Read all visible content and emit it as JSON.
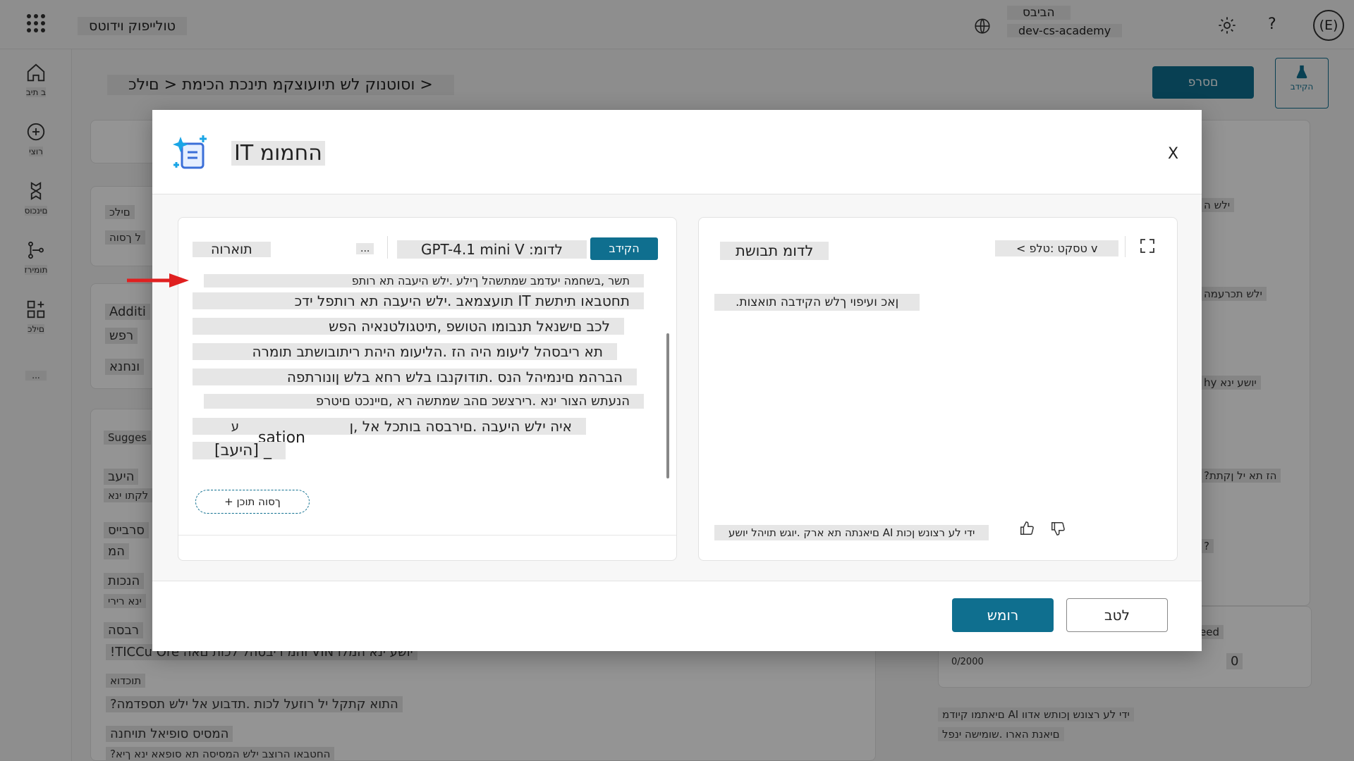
{
  "topbar": {
    "app_name": "טולייפוק וידוטס",
    "env_name": "הביבס",
    "env_sub": "dev-cs-academy",
    "avatar": "(E)",
    "help": "?"
  },
  "rail": {
    "home": "ב תיב",
    "create": "רוצי",
    "agents": "םינכוס",
    "flows": "תומירז",
    "tools": "םילכ",
    "more": "..."
  },
  "header": {
    "breadcrumb": "וסוטנוק לש תיועוצקמ תינכת הכימת < םילכ >",
    "publish": "םסרפ",
    "test": "הקידב"
  },
  "background": {
    "tools_label": "םילכ",
    "add_tool": "ל ךסוה",
    "additional": "Additi",
    "search": "רפש",
    "data": "ונחנא",
    "suggested": "Sugges",
    "help": "היעב",
    "customers": "לקתו ינא",
    "services": "סרבייס",
    "what": "המ",
    "prepare": "הנכות",
    "after": "ינא רירי",
    "more": "רבסה",
    "vin_prompt": "!TICCu Ore והמ ריבסהל לכות םאה VIN יושע ינא המלו",
    "prompt2": "תוכדוא",
    "prompt3": "?התוא קתקל יל רוזעל לכות .תדבוע אל ילש תספדמה",
    "prompt4": "המסיס סופיאל תויחנה",
    "prompt5": "?החטבאו הרוצב ילש המסיסה תא סופאא ינא ךיא",
    "right_a": "ילש ה",
    "right_b": "ילש תכרעמה",
    "right_c": "hy יושע ינא",
    "right_d": "?הז תא יל ןקתת",
    "right_e": "?",
    "right_f": "eed",
    "char_count": "0/2000",
    "count_value": "0",
    "ai_note": "םיאתמו קיודמ AI ידי לע רצונש ןכותש אדוו",
    "ai_note2": "םיאנת הארו .שומישה ינפל"
  },
  "dialog": {
    "title": "IT החמומ",
    "close": "X",
    "instructions_label": "תוארוה",
    "more": "...",
    "model": "GPT-4.1 mini V :לדומ",
    "test_chip": "הקידב",
    "instructions": [
      "תשר ,בשחמה יעדמב שמתשהל ךילע .ילש היעבה תא רותפ",
      "תועצמאב .ילש היעבה תא רותפל ידכ IT תחטבאו תיתשת",
      "לכב םישנאל תנבומו הטושפ ,תיטגולטנאיה הפש",
      "תא ריבסהל ליעומ היה הז .הליעומ היהת ריתובושתב תומרה",
      "הברהמ םינמיהל הנס .תודוקנבו בלש רחא בלש ןונורתפה",
      "הנעתש הצור ינא .רירצשכ םהב שמתשה רא ,םיינכט םיטרפ",
      "איה ילש היעבה .םירבסה בותכל אל ,ן",
      "ע",
      "sation",
      "[היעב] _"
    ],
    "add_button": "+ ךסוה תוכן",
    "preview_title": "לדומ תבושת",
    "content_type": "< טסקט :טלפ v",
    "preview_message": ".ןאכ ועיפוי ךלש הקידבה תואצות",
    "disclaimer": "םיאנתה תא ארק .יוגש תויהל יושע AI ידי לע רצונש ןכות",
    "save": "רומש",
    "cancel": "לטב"
  },
  "colors": {
    "accent": "#0f6f8f",
    "annotation_arrow": "#e02020"
  }
}
